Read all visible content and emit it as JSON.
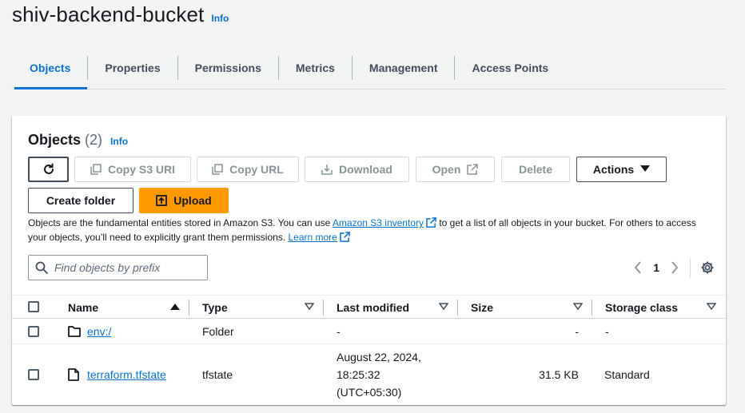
{
  "header": {
    "title": "shiv-backend-bucket",
    "info": "Info"
  },
  "tabs": [
    {
      "label": "Objects",
      "active": true
    },
    {
      "label": "Properties"
    },
    {
      "label": "Permissions"
    },
    {
      "label": "Metrics"
    },
    {
      "label": "Management"
    },
    {
      "label": "Access Points"
    }
  ],
  "panel": {
    "title": "Objects",
    "count": "(2)",
    "info": "Info"
  },
  "toolbar": {
    "copy_uri": "Copy S3 URI",
    "copy_url": "Copy URL",
    "download": "Download",
    "open": "Open",
    "delete": "Delete",
    "actions": "Actions",
    "create_folder": "Create folder",
    "upload": "Upload"
  },
  "description": {
    "part1": "Objects are the fundamental entities stored in Amazon S3. You can use ",
    "link1": "Amazon S3 inventory",
    "part2": " to get a list of all objects in your bucket. For others to access your objects, you’ll need to explicitly grant them permissions. ",
    "link2": "Learn more"
  },
  "search": {
    "placeholder": "Find objects by prefix",
    "value": ""
  },
  "pagination": {
    "page": "1"
  },
  "table": {
    "columns": {
      "name": "Name",
      "type": "Type",
      "last_modified": "Last modified",
      "size": "Size",
      "storage_class": "Storage class"
    },
    "rows": [
      {
        "name": "env:/",
        "icon": "folder-icon",
        "type": "Folder",
        "last_modified": "-",
        "size": "-",
        "storage_class": "-"
      },
      {
        "name": "terraform.tfstate",
        "icon": "file-icon",
        "type": "tfstate",
        "last_modified_line1": "August 22, 2024,",
        "last_modified_line2": "18:25:32",
        "last_modified_line3": "(UTC+05:30)",
        "size": "31.5 KB",
        "storage_class": "Standard"
      }
    ]
  },
  "colors": {
    "accent": "#0972d3",
    "primary_button": "#ff9900",
    "text": "#16191f",
    "background": "#f2f3f3"
  }
}
